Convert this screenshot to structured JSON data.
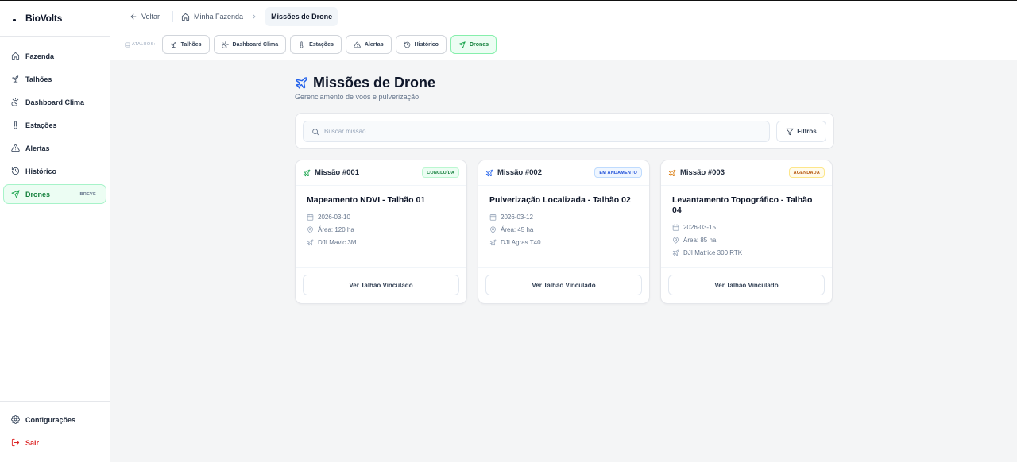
{
  "app": {
    "name": "BioVolts"
  },
  "sidebar": {
    "items": [
      {
        "label": "Fazenda",
        "icon": "home-icon"
      },
      {
        "label": "Talhões",
        "icon": "sprout-icon"
      },
      {
        "label": "Dashboard Clima",
        "icon": "cloud-sun-icon"
      },
      {
        "label": "Estações",
        "icon": "thermometer-icon"
      },
      {
        "label": "Alertas",
        "icon": "alert-triangle-icon"
      },
      {
        "label": "Histórico",
        "icon": "history-icon"
      },
      {
        "label": "Drones",
        "icon": "send-icon",
        "badge": "BREVE",
        "active": true
      }
    ],
    "footer": [
      {
        "label": "Configurações",
        "icon": "gear-icon"
      },
      {
        "label": "Sair",
        "icon": "logout-icon"
      }
    ]
  },
  "breadcrumb": {
    "back": "Voltar",
    "home": "Minha Fazenda",
    "current": "Missões de Drone"
  },
  "shortcuts": {
    "label": "ATALHOS:",
    "items": [
      {
        "label": "Talhões",
        "icon": "sprout-icon"
      },
      {
        "label": "Dashboard Clima",
        "icon": "cloud-sun-icon"
      },
      {
        "label": "Estações",
        "icon": "thermometer-icon"
      },
      {
        "label": "Alertas",
        "icon": "alert-triangle-icon"
      },
      {
        "label": "Histórico",
        "icon": "history-icon"
      },
      {
        "label": "Drones",
        "icon": "send-icon",
        "active": true
      }
    ]
  },
  "page": {
    "title": "Missões de Drone",
    "subtitle": "Gerenciamento de voos e pulverização"
  },
  "search": {
    "placeholder": "Buscar missão...",
    "value": "",
    "filter_label": "Filtros"
  },
  "missions": [
    {
      "id": "Missão #001",
      "status": "CONCLUÍDA",
      "status_color": "#15803d",
      "icon_color": "#16a34a",
      "title": "Mapeamento NDVI - Talhão 01",
      "date": "2026-03-10",
      "area": "Área: 120 ha",
      "drone": "DJI Mavic 3M",
      "action": "Ver Talhão Vinculado"
    },
    {
      "id": "Missão #002",
      "status": "EM ANDAMENTO",
      "status_color": "#1d4ed8",
      "icon_color": "#2563eb",
      "title": "Pulverização Localizada - Talhão 02",
      "date": "2026-03-12",
      "area": "Área: 45 ha",
      "drone": "DJI Agras T40",
      "action": "Ver Talhão Vinculado"
    },
    {
      "id": "Missão #003",
      "status": "AGENDADA",
      "status_color": "#b45309",
      "icon_color": "#d97706",
      "title": "Levantamento Topográfico - Talhão 04",
      "date": "2026-03-15",
      "area": "Área: 85 ha",
      "drone": "DJI Matrice 300 RTK",
      "action": "Ver Talhão Vinculado"
    }
  ]
}
